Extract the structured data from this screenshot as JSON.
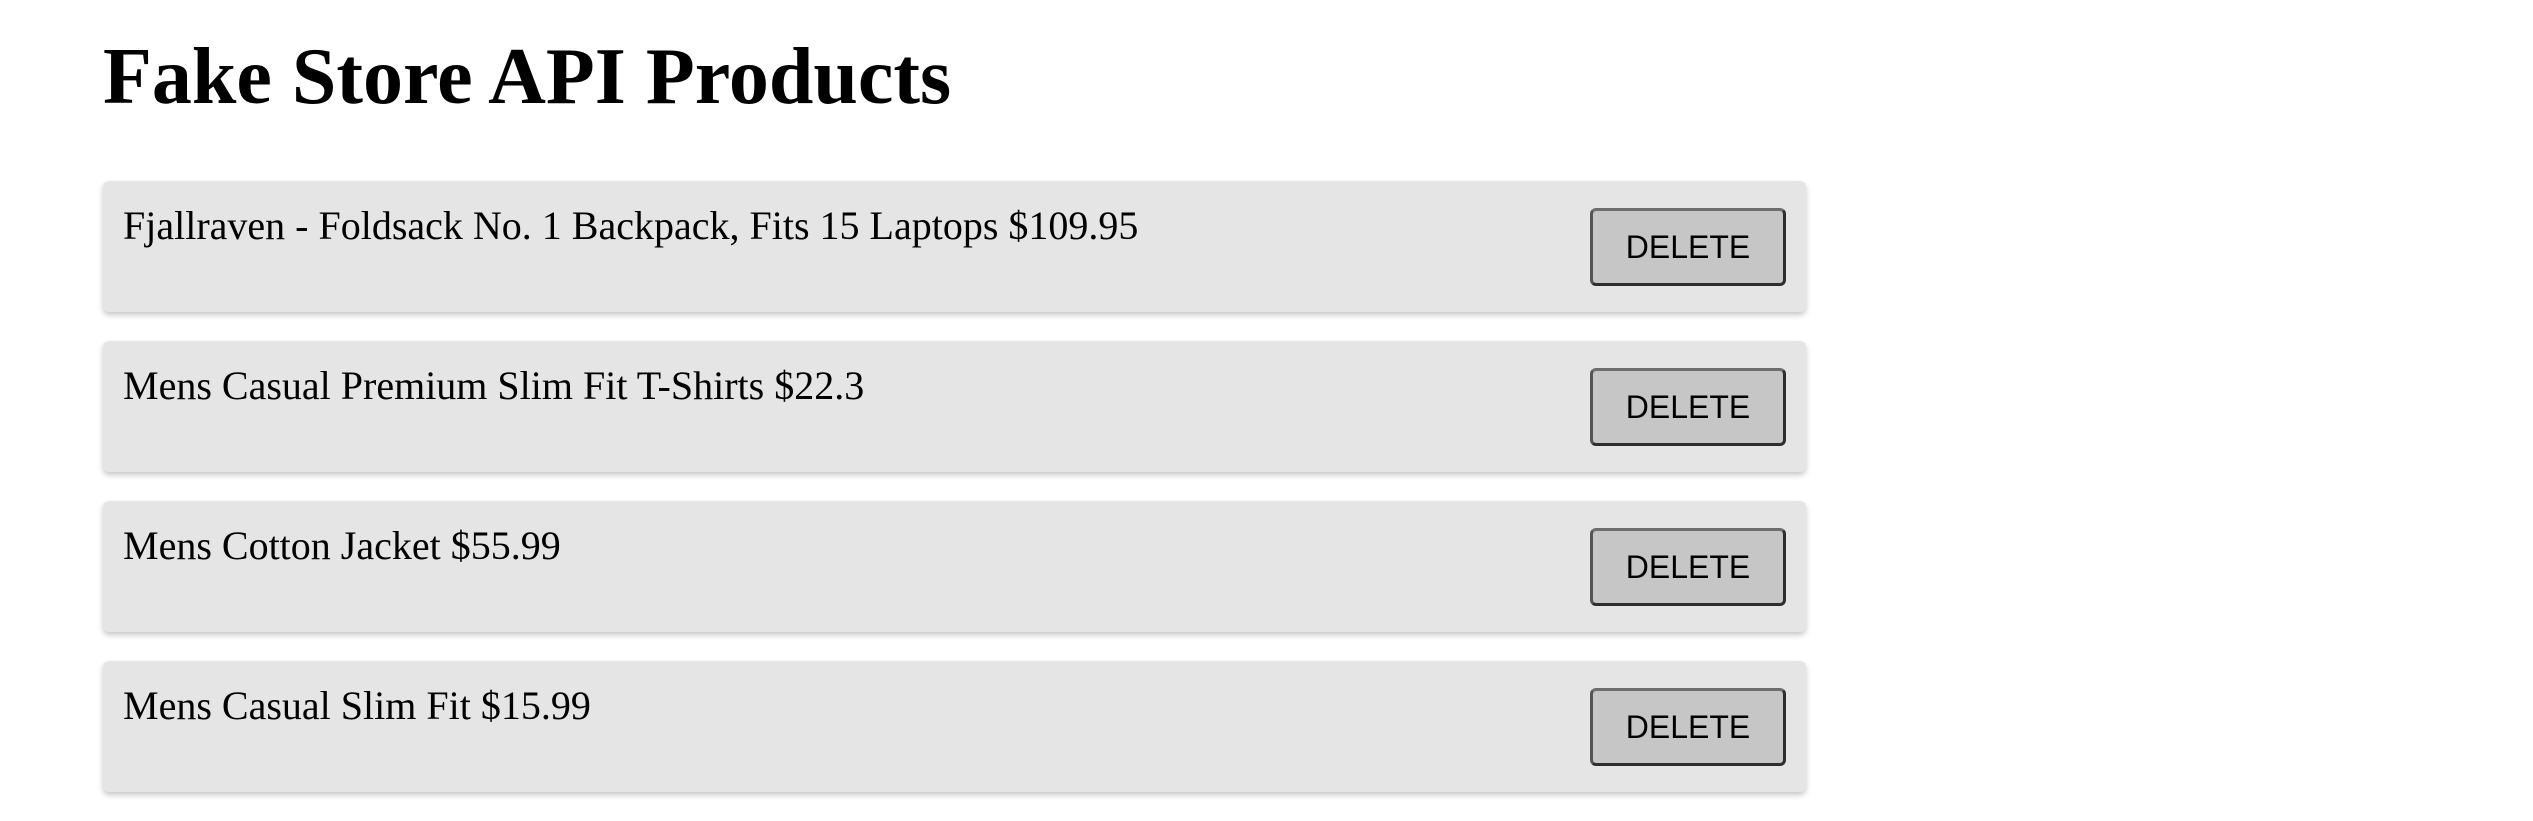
{
  "page": {
    "title": "Fake Store API Products"
  },
  "products": [
    {
      "text": "Fjallraven - Foldsack No. 1 Backpack, Fits 15 Laptops $109.95",
      "delete_label": "DELETE"
    },
    {
      "text": "Mens Casual Premium Slim Fit T-Shirts $22.3",
      "delete_label": "DELETE"
    },
    {
      "text": "Mens Cotton Jacket $55.99",
      "delete_label": "DELETE"
    },
    {
      "text": "Mens Casual Slim Fit $15.99",
      "delete_label": "DELETE"
    }
  ]
}
